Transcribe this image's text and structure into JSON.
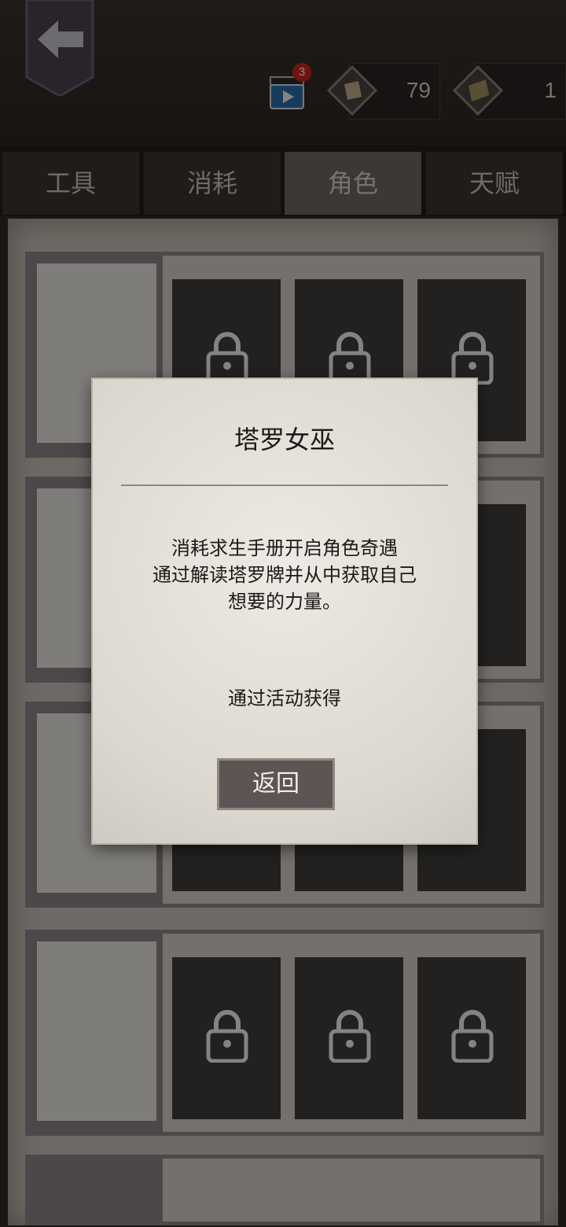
{
  "header": {
    "video_badge": "3",
    "currencies": [
      {
        "icon": "gem-icon",
        "value": "79"
      },
      {
        "icon": "manual-token-icon",
        "value": "1"
      }
    ]
  },
  "tabs": [
    {
      "label": "工具",
      "active": false
    },
    {
      "label": "消耗",
      "active": false
    },
    {
      "label": "角色",
      "active": true
    },
    {
      "label": "天赋",
      "active": false
    }
  ],
  "dialog": {
    "title": "塔罗女巫",
    "description": [
      "消耗求生手册开启角色奇遇",
      "通过解读塔罗牌并从中获取自己",
      "想要的力量。"
    ],
    "source": "通过活动获得",
    "return_label": "返回"
  },
  "colors": {
    "accent": "#c8231b",
    "panel": "#c7c2b9",
    "dialog": "#e4e1da",
    "button": "#5d5553"
  }
}
